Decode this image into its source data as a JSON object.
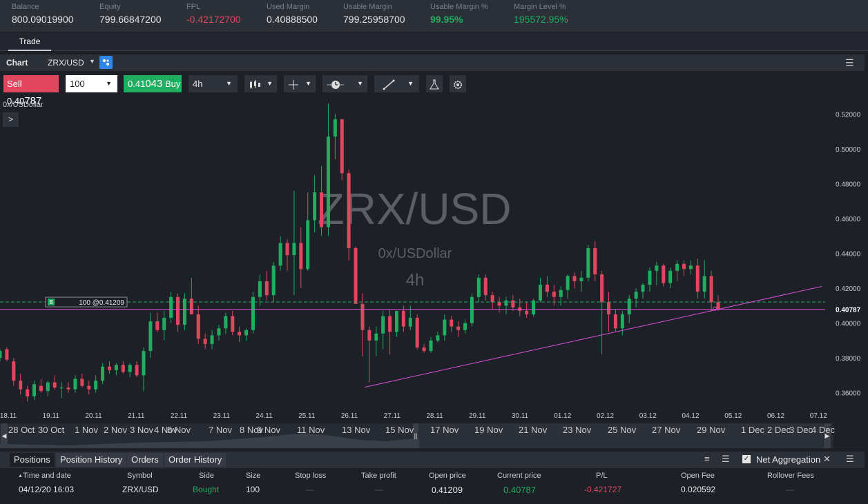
{
  "account": {
    "balance_label": "Balance",
    "balance": "800.09019900",
    "equity_label": "Equity",
    "equity": "799.66847200",
    "fpl_label": "FPL",
    "fpl": "-0.42172700",
    "used_margin_label": "Used Margin",
    "used_margin": "0.40888500",
    "usable_margin_label": "Usable Margin",
    "usable_margin": "799.25958700",
    "usable_margin_pct_label": "Usable Margin %",
    "usable_margin_pct": "99.95%",
    "margin_level_label": "Margin Level %",
    "margin_level": "195572.95%"
  },
  "tabs": {
    "trade": "Trade"
  },
  "chart_header": {
    "title": "Chart",
    "symbol": "ZRX/USD",
    "dropdown": "▼",
    "link_icon": "link-icon",
    "menu_icon": "☰"
  },
  "toolbar": {
    "sell_label": "Sell",
    "sell_price_main": "0.40",
    "sell_price_big": "787",
    "quantity": "100",
    "quantity_arrow": "▼",
    "buy_price_main": "0.41",
    "buy_price_big": "043",
    "buy_label": "Buy",
    "timeframe": "4h",
    "timeframe_arrow": "▼",
    "candle_icon": "candlestick-icon",
    "crosshair_icon": "crosshair-icon",
    "clock_icon": "clock-icon",
    "draw_icon": "draw-line-icon",
    "flask_icon": "flask-icon",
    "settings_icon": "gear-icon",
    "arrow": "▼"
  },
  "chart": {
    "instrument_label": "0x/USDollar",
    "expander": ">",
    "watermark_symbol": "ZRX/USD",
    "watermark_name": "0x/USDollar",
    "watermark_tf": "4h",
    "position_line_badge": "B",
    "position_line_label": "100 @0.41209",
    "current_price_label": "0.40787",
    "y_ticks": [
      "0.52000",
      "0.50000",
      "0.48000",
      "0.46000",
      "0.44000",
      "0.42000",
      "0.40000",
      "0.38000",
      "0.36000"
    ],
    "x_ticks": [
      "18.11",
      "19.11",
      "20.11",
      "21.11",
      "22.11",
      "23.11",
      "24.11",
      "25.11",
      "26.11",
      "27.11",
      "28.11",
      "29.11",
      "30.11",
      "01.12",
      "02.12",
      "03.12",
      "04.12",
      "05.12",
      "06.12",
      "07.12"
    ],
    "colors": {
      "up": "#1fae5f",
      "down": "#e0475e",
      "trendline": "#d94fd6",
      "position_line": "#1fae5f"
    }
  },
  "chart_data": {
    "type": "candlestick",
    "title": "ZRX/USD",
    "subtitle": "0x/USDollar",
    "timeframe": "4h",
    "ylim": [
      0.35,
      0.525
    ],
    "x_labels": [
      "18.11",
      "19.11",
      "20.11",
      "21.11",
      "22.11",
      "23.11",
      "24.11",
      "25.11",
      "26.11",
      "27.11",
      "28.11",
      "29.11",
      "30.11",
      "01.12",
      "02.12",
      "03.12",
      "04.12",
      "05.12",
      "06.12",
      "07.12"
    ],
    "candles": [
      [
        0.38,
        0.385,
        0.378,
        0.384
      ],
      [
        0.385,
        0.386,
        0.378,
        0.379
      ],
      [
        0.378,
        0.38,
        0.364,
        0.367
      ],
      [
        0.367,
        0.371,
        0.359,
        0.362
      ],
      [
        0.362,
        0.364,
        0.355,
        0.358
      ],
      [
        0.358,
        0.367,
        0.356,
        0.365
      ],
      [
        0.364,
        0.368,
        0.36,
        0.361
      ],
      [
        0.361,
        0.367,
        0.358,
        0.366
      ],
      [
        0.366,
        0.37,
        0.362,
        0.363
      ],
      [
        0.363,
        0.366,
        0.357,
        0.363
      ],
      [
        0.363,
        0.366,
        0.36,
        0.362
      ],
      [
        0.362,
        0.37,
        0.36,
        0.368
      ],
      [
        0.368,
        0.371,
        0.363,
        0.364
      ],
      [
        0.364,
        0.367,
        0.359,
        0.362
      ],
      [
        0.362,
        0.37,
        0.36,
        0.367
      ],
      [
        0.367,
        0.377,
        0.365,
        0.375
      ],
      [
        0.375,
        0.378,
        0.371,
        0.373
      ],
      [
        0.373,
        0.377,
        0.37,
        0.376
      ],
      [
        0.376,
        0.378,
        0.371,
        0.372
      ],
      [
        0.372,
        0.377,
        0.369,
        0.376
      ],
      [
        0.376,
        0.378,
        0.369,
        0.37
      ],
      [
        0.37,
        0.386,
        0.361,
        0.384
      ],
      [
        0.384,
        0.406,
        0.38,
        0.401
      ],
      [
        0.401,
        0.406,
        0.395,
        0.396
      ],
      [
        0.396,
        0.407,
        0.39,
        0.403
      ],
      [
        0.403,
        0.418,
        0.4,
        0.415
      ],
      [
        0.415,
        0.417,
        0.395,
        0.399
      ],
      [
        0.399,
        0.417,
        0.396,
        0.414
      ],
      [
        0.414,
        0.426,
        0.407,
        0.405
      ],
      [
        0.405,
        0.41,
        0.388,
        0.391
      ],
      [
        0.391,
        0.394,
        0.385,
        0.388
      ],
      [
        0.388,
        0.396,
        0.385,
        0.393
      ],
      [
        0.393,
        0.399,
        0.39,
        0.397
      ],
      [
        0.397,
        0.406,
        0.394,
        0.404
      ],
      [
        0.404,
        0.407,
        0.393,
        0.395
      ],
      [
        0.395,
        0.398,
        0.389,
        0.393
      ],
      [
        0.393,
        0.397,
        0.39,
        0.396
      ],
      [
        0.396,
        0.418,
        0.394,
        0.415
      ],
      [
        0.415,
        0.428,
        0.41,
        0.424
      ],
      [
        0.424,
        0.43,
        0.413,
        0.416
      ],
      [
        0.416,
        0.435,
        0.412,
        0.433
      ],
      [
        0.433,
        0.45,
        0.43,
        0.446
      ],
      [
        0.446,
        0.448,
        0.43,
        0.439
      ],
      [
        0.439,
        0.476,
        0.416,
        0.446
      ],
      [
        0.446,
        0.455,
        0.42,
        0.431
      ],
      [
        0.431,
        0.475,
        0.43,
        0.459
      ],
      [
        0.459,
        0.485,
        0.452,
        0.475
      ],
      [
        0.475,
        0.49,
        0.45,
        0.455
      ],
      [
        0.455,
        0.526,
        0.45,
        0.507
      ],
      [
        0.507,
        0.52,
        0.494,
        0.517
      ],
      [
        0.517,
        0.512,
        0.482,
        0.486
      ],
      [
        0.486,
        0.488,
        0.436,
        0.443
      ],
      [
        0.443,
        0.444,
        0.411,
        0.411
      ],
      [
        0.411,
        0.417,
        0.381,
        0.396
      ],
      [
        0.396,
        0.398,
        0.366,
        0.39
      ],
      [
        0.39,
        0.398,
        0.381,
        0.394
      ],
      [
        0.394,
        0.407,
        0.385,
        0.404
      ],
      [
        0.404,
        0.408,
        0.382,
        0.395
      ],
      [
        0.395,
        0.406,
        0.392,
        0.407
      ],
      [
        0.407,
        0.41,
        0.395,
        0.398
      ],
      [
        0.398,
        0.41,
        0.396,
        0.403
      ],
      [
        0.403,
        0.405,
        0.385,
        0.386
      ],
      [
        0.386,
        0.388,
        0.383,
        0.384
      ],
      [
        0.384,
        0.392,
        0.383,
        0.39
      ],
      [
        0.39,
        0.395,
        0.389,
        0.393
      ],
      [
        0.393,
        0.405,
        0.39,
        0.402
      ],
      [
        0.402,
        0.404,
        0.395,
        0.398
      ],
      [
        0.398,
        0.401,
        0.392,
        0.396
      ],
      [
        0.396,
        0.402,
        0.394,
        0.4
      ],
      [
        0.4,
        0.417,
        0.398,
        0.415
      ],
      [
        0.415,
        0.428,
        0.412,
        0.426
      ],
      [
        0.426,
        0.428,
        0.413,
        0.416
      ],
      [
        0.416,
        0.418,
        0.408,
        0.412
      ],
      [
        0.412,
        0.415,
        0.406,
        0.41
      ],
      [
        0.41,
        0.415,
        0.405,
        0.413
      ],
      [
        0.413,
        0.416,
        0.407,
        0.409
      ],
      [
        0.409,
        0.414,
        0.404,
        0.407
      ],
      [
        0.407,
        0.412,
        0.403,
        0.405
      ],
      [
        0.405,
        0.414,
        0.404,
        0.413
      ],
      [
        0.413,
        0.426,
        0.412,
        0.422
      ],
      [
        0.422,
        0.427,
        0.415,
        0.418
      ],
      [
        0.418,
        0.422,
        0.41,
        0.415
      ],
      [
        0.415,
        0.421,
        0.41,
        0.419
      ],
      [
        0.419,
        0.428,
        0.414,
        0.427
      ],
      [
        0.427,
        0.429,
        0.42,
        0.424
      ],
      [
        0.424,
        0.43,
        0.418,
        0.426
      ],
      [
        0.426,
        0.445,
        0.424,
        0.443
      ],
      [
        0.443,
        0.447,
        0.424,
        0.428
      ],
      [
        0.428,
        0.43,
        0.382,
        0.412
      ],
      [
        0.412,
        0.418,
        0.395,
        0.405
      ],
      [
        0.405,
        0.408,
        0.395,
        0.397
      ],
      [
        0.397,
        0.407,
        0.393,
        0.405
      ],
      [
        0.405,
        0.416,
        0.4,
        0.414
      ],
      [
        0.414,
        0.42,
        0.409,
        0.418
      ],
      [
        0.418,
        0.423,
        0.414,
        0.422
      ],
      [
        0.422,
        0.432,
        0.418,
        0.43
      ],
      [
        0.43,
        0.435,
        0.422,
        0.433
      ],
      [
        0.433,
        0.434,
        0.421,
        0.423
      ],
      [
        0.423,
        0.432,
        0.42,
        0.43
      ],
      [
        0.43,
        0.436,
        0.424,
        0.434
      ],
      [
        0.434,
        0.436,
        0.427,
        0.431
      ],
      [
        0.431,
        0.436,
        0.428,
        0.433
      ],
      [
        0.433,
        0.437,
        0.414,
        0.418
      ],
      [
        0.418,
        0.436,
        0.414,
        0.427
      ],
      [
        0.427,
        0.43,
        0.407,
        0.412
      ],
      [
        0.412,
        0.416,
        0.407,
        0.408
      ]
    ],
    "current_price": 0.40787,
    "position_price": 0.41209,
    "trendline": [
      [
        0.365,
        0.363
      ],
      [
        1.0,
        0.421
      ]
    ],
    "horizontal_line": 0.40787
  },
  "navigator": {
    "labels": [
      "28 Oct",
      "30 Oct",
      "1 Nov",
      "2 Nov",
      "3 Nov",
      "4 Nov",
      "5 Nov",
      "7 Nov",
      "8 Nov",
      "9 Nov",
      "11 Nov",
      "13 Nov",
      "15 Nov",
      "17 Nov",
      "19 Nov",
      "21 Nov",
      "23 Nov",
      "25 Nov",
      "27 Nov",
      "29 Nov",
      "1 Dec",
      "2 Dec",
      "3 Dec",
      "4 Dec"
    ],
    "left_arrow": "◀",
    "right_arrow": "▶",
    "handle": "||"
  },
  "positions": {
    "tabs": [
      "Positions",
      "Position History",
      "Orders",
      "Order History"
    ],
    "net_aggregation": "Net Aggregation",
    "check": "✓",
    "close": "✕",
    "menu": "☰",
    "list_icon": "≡",
    "columns": [
      "Time and date",
      "Symbol",
      "Side",
      "Size",
      "Stop loss",
      "Take profit",
      "Open price",
      "Current price",
      "P/L",
      "Open Fee",
      "Rollover Fees"
    ],
    "sort_arrow": "▲",
    "row": {
      "time": "04/12/20 16:03",
      "symbol": "ZRX/USD",
      "side": "Bought",
      "size": "100",
      "stop_loss": "—",
      "take_profit": "—",
      "open_price_main": "0.41",
      "open_price_big": "209",
      "current_price": "0.40787",
      "pl": "-0.421727",
      "open_fee": "0.020592",
      "rollover": "—"
    }
  }
}
